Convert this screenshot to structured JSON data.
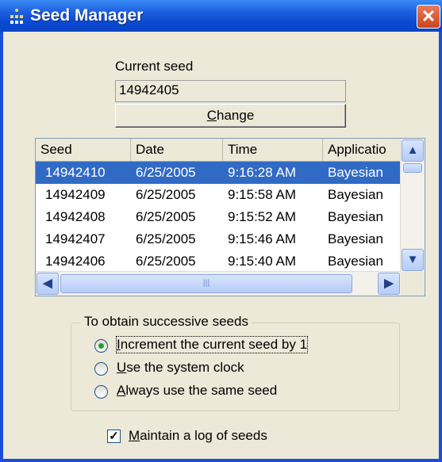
{
  "window": {
    "title": "Seed Manager",
    "close_glyph": "✕"
  },
  "current_seed": {
    "label": "Current seed",
    "value": "14942405",
    "change_button": "Change"
  },
  "seed_list": {
    "columns": [
      "Seed",
      "Date",
      "Time",
      "Applicatio"
    ],
    "rows": [
      {
        "seed": "14942410",
        "date": "6/25/2005",
        "time": "9:16:28 AM",
        "application": "Bayesian",
        "selected": true
      },
      {
        "seed": "14942409",
        "date": "6/25/2005",
        "time": "9:15:58 AM",
        "application": "Bayesian",
        "selected": false
      },
      {
        "seed": "14942408",
        "date": "6/25/2005",
        "time": "9:15:52 AM",
        "application": "Bayesian",
        "selected": false
      },
      {
        "seed": "14942407",
        "date": "6/25/2005",
        "time": "9:15:46 AM",
        "application": "Bayesian",
        "selected": false
      },
      {
        "seed": "14942406",
        "date": "6/25/2005",
        "time": "9:15:40 AM",
        "application": "Bayesian",
        "selected": false
      }
    ],
    "scroll_glyphs": {
      "up": "▲",
      "down": "▼",
      "left": "◀",
      "right": "▶",
      "grip": "|||"
    }
  },
  "successive_seeds": {
    "title": "To obtain successive seeds",
    "options": [
      {
        "label": "Increment the current seed by 1",
        "selected": true
      },
      {
        "label": "Use the system clock",
        "selected": false
      },
      {
        "label": "Always use the same seed",
        "selected": false
      }
    ]
  },
  "log_option": {
    "label": "Maintain a log of seeds",
    "checked": true,
    "check_glyph": "✓"
  },
  "colors": {
    "title_bar": "#0a49d2",
    "selection": "#316ac5",
    "dialog_bg": "#ece9d8"
  }
}
